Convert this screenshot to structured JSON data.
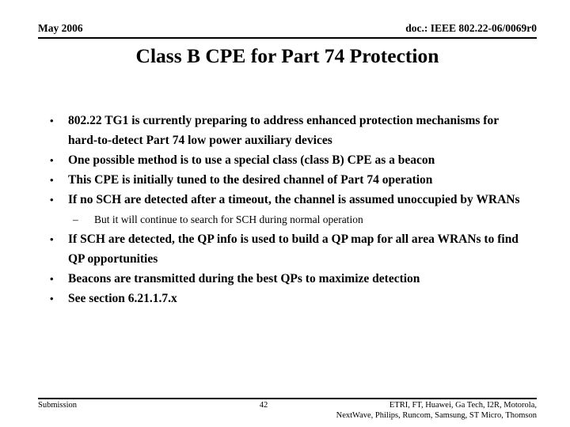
{
  "header": {
    "date": "May 2006",
    "doc": "doc.: IEEE 802.22-06/0069r0"
  },
  "title": "Class B CPE for Part 74 Protection",
  "bullets": [
    {
      "level": 1,
      "marker": "•",
      "text": "802.22 TG1 is currently preparing to address enhanced protection mechanisms for hard-to-detect Part 74 low power auxiliary devices"
    },
    {
      "level": 1,
      "marker": "•",
      "text": "One possible method is to use a special class (class B) CPE as a beacon"
    },
    {
      "level": 1,
      "marker": "•",
      "text": "This CPE is initially tuned to the desired channel of Part 74 operation"
    },
    {
      "level": 1,
      "marker": "•",
      "text": "If no SCH are detected after a timeout, the channel is assumed unoccupied by WRANs"
    },
    {
      "level": 2,
      "marker": "–",
      "text": "But it will continue to search for SCH during normal operation"
    },
    {
      "level": 1,
      "marker": "•",
      "text": "If SCH are detected, the QP info is used to build a QP map for all area WRANs to find QP opportunities"
    },
    {
      "level": 1,
      "marker": "•",
      "text": "Beacons are transmitted during the best QPs to maximize detection"
    },
    {
      "level": 1,
      "marker": "•",
      "text": "See section 6.21.1.7.x"
    }
  ],
  "footer": {
    "left": "Submission",
    "page": "42",
    "right_line1": "ETRI, FT, Huawei, Ga Tech, I2R, Motorola,",
    "right_line2": "NextWave, Philips, Runcom, Samsung, ST Micro, Thomson"
  }
}
